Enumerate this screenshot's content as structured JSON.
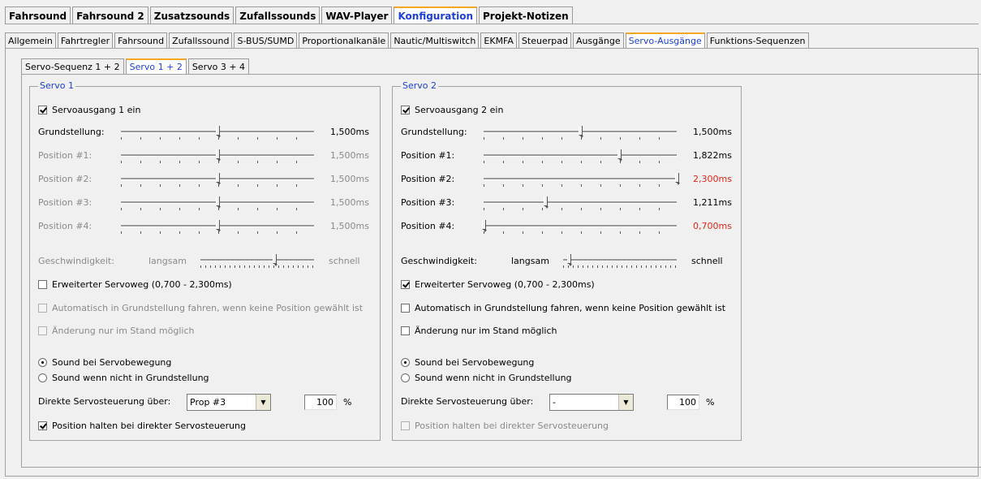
{
  "top_tabs": [
    "Fahrsound",
    "Fahrsound 2",
    "Zusatzsounds",
    "Zufallssounds",
    "WAV-Player",
    "Konfiguration",
    "Projekt-Notizen"
  ],
  "top_tab_active": 5,
  "sub_tabs": [
    "Allgemein",
    "Fahrtregler",
    "Fahrsound",
    "Zufallssound",
    "S-BUS/SUMD",
    "Proportionalkanäle",
    "Nautic/Multiswitch",
    "EKMFA",
    "Steuerpad",
    "Ausgänge",
    "Servo-Ausgänge",
    "Funktions-Sequenzen"
  ],
  "sub_tab_active": 10,
  "servo_tabs": [
    "Servo-Sequenz 1 + 2",
    "Servo 1 + 2",
    "Servo 3 + 4"
  ],
  "servo_tab_active": 1,
  "servo1": {
    "title": "Servo 1",
    "enable_label": "Servoausgang 1 ein",
    "enabled": true,
    "sliders": [
      {
        "label": "Grundstellung:",
        "value": "1,500ms",
        "level": 0.5,
        "enabled": true,
        "red": false
      },
      {
        "label": "Position #1:",
        "value": "1,500ms",
        "level": 0.5,
        "enabled": false,
        "red": false
      },
      {
        "label": "Position #2:",
        "value": "1,500ms",
        "level": 0.5,
        "enabled": false,
        "red": false
      },
      {
        "label": "Position #3:",
        "value": "1,500ms",
        "level": 0.5,
        "enabled": false,
        "red": false
      },
      {
        "label": "Position #4:",
        "value": "1,500ms",
        "level": 0.5,
        "enabled": false,
        "red": false
      }
    ],
    "speed_label": "Geschwindigkeit:",
    "speed_slow": "langsam",
    "speed_fast": "schnell",
    "speed_level": 0.65,
    "speed_enabled": false,
    "extended_label": "Erweiterter Servoweg (0,700 - 2,300ms)",
    "extended": false,
    "auto_label": "Automatisch in Grundstellung fahren, wenn keine Position gewählt ist",
    "auto": false,
    "auto_enabled": false,
    "standstill_label": "Änderung nur im Stand möglich",
    "standstill": false,
    "standstill_enabled": false,
    "radio1_label": "Sound bei Servobewegung",
    "radio2_label": "Sound wenn nicht in Grundstellung",
    "radio_selected": 1,
    "direct_label": "Direkte Servosteuerung über:",
    "direct_value": "Prop #3",
    "percent_value": "100",
    "percent_unit": "%",
    "hold_label": "Position halten bei direkter Servosteuerung",
    "hold": true,
    "hold_enabled": true
  },
  "servo2": {
    "title": "Servo 2",
    "enable_label": "Servoausgang 2 ein",
    "enabled": true,
    "sliders": [
      {
        "label": "Grundstellung:",
        "value": "1,500ms",
        "level": 0.5,
        "enabled": true,
        "red": false
      },
      {
        "label": "Position #1:",
        "value": "1,822ms",
        "level": 0.7,
        "enabled": true,
        "red": false
      },
      {
        "label": "Position #2:",
        "value": "2,300ms",
        "level": 1.0,
        "enabled": true,
        "red": true
      },
      {
        "label": "Position #3:",
        "value": "1,211ms",
        "level": 0.32,
        "enabled": true,
        "red": false
      },
      {
        "label": "Position #4:",
        "value": "0,700ms",
        "level": 0.0,
        "enabled": true,
        "red": true
      }
    ],
    "speed_label": "Geschwindigkeit:",
    "speed_slow": "langsam",
    "speed_fast": "schnell",
    "speed_level": 0.05,
    "speed_enabled": true,
    "extended_label": "Erweiterter Servoweg (0,700 - 2,300ms)",
    "extended": true,
    "auto_label": "Automatisch in Grundstellung fahren, wenn keine Position gewählt ist",
    "auto": false,
    "auto_enabled": true,
    "standstill_label": "Änderung nur im Stand möglich",
    "standstill": false,
    "standstill_enabled": true,
    "radio1_label": "Sound bei Servobewegung",
    "radio2_label": "Sound wenn nicht in Grundstellung",
    "radio_selected": 1,
    "direct_label": "Direkte Servosteuerung über:",
    "direct_value": "-",
    "percent_value": "100",
    "percent_unit": "%",
    "hold_label": "Position halten bei direkter Servosteuerung",
    "hold": false,
    "hold_enabled": false
  }
}
